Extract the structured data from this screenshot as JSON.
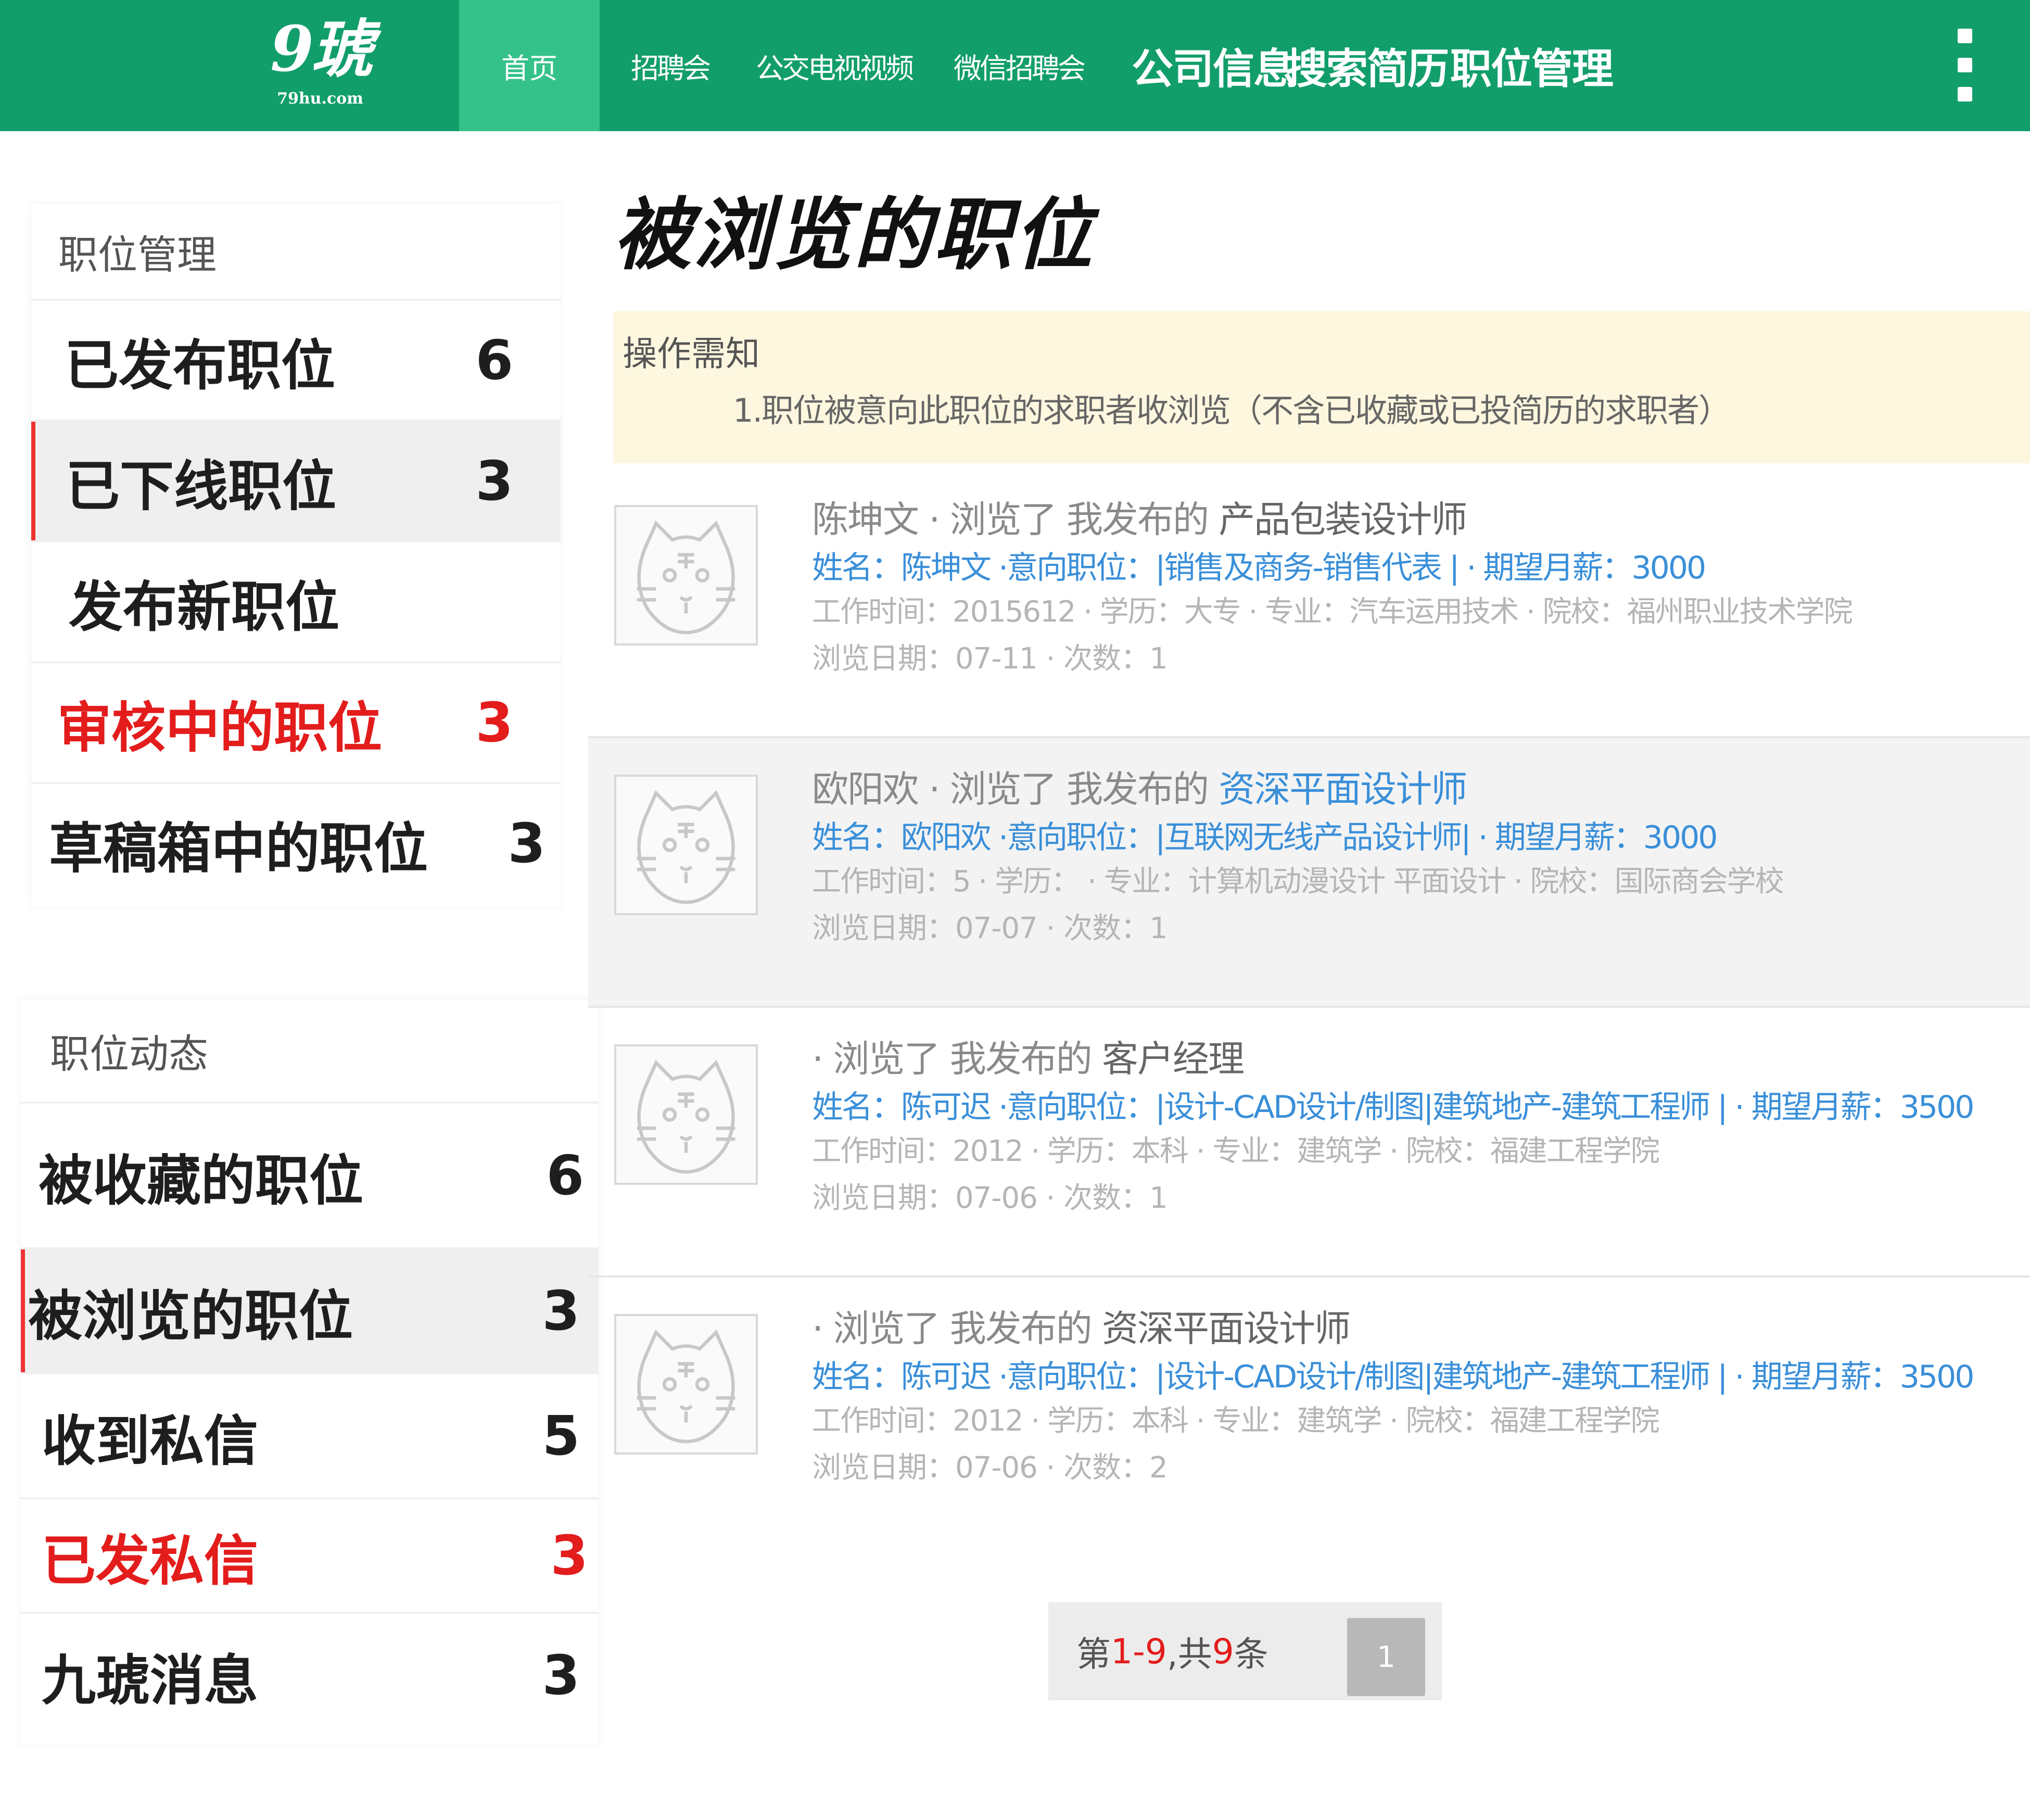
{
  "brand": {
    "logo_main": "9琥",
    "logo_sub": "79hu.com"
  },
  "nav": {
    "home": "首页",
    "items_small": [
      "招聘会",
      "公交电视视频",
      "微信招聘会"
    ],
    "items_big": [
      "公司信息",
      "搜索简历",
      "职位管理"
    ]
  },
  "sidebar": {
    "section1": {
      "title": "职位管理",
      "items": [
        {
          "label": "已发布职位",
          "count": "6"
        },
        {
          "label": "已下线职位",
          "count": "3"
        },
        {
          "label": "发布新职位",
          "count": ""
        },
        {
          "label": "审核中的职位",
          "count": "3"
        },
        {
          "label": "草稿箱中的职位",
          "count": "3"
        }
      ]
    },
    "section2": {
      "title": "职位动态",
      "items": [
        {
          "label": "被收藏的职位",
          "count": "6"
        },
        {
          "label": "被浏览的职位",
          "count": "3"
        },
        {
          "label": "收到私信",
          "count": "5"
        },
        {
          "label": "已发私信",
          "count": "3"
        },
        {
          "label": "九琥消息",
          "count": "3"
        }
      ]
    }
  },
  "main": {
    "title": "被浏览的职位",
    "notice": {
      "title": "操作需知",
      "text": "1.职位被意向此职位的求职者收浏览（不含已收藏或已投简历的求职者）"
    },
    "records": [
      {
        "viewer": "陈坤文",
        "action": " · 浏览了 我发布的 ",
        "job": "产品包装设计师",
        "info": "姓名：陈坤文 ·意向职位：|销售及商务-销售代表 | · 期望月薪：3000",
        "meta": "工作时间：2015612 · 学历：大专 · 专业：汽车运用技术 · 院校：福州职业技术学院",
        "date": "浏览日期：07-11 · 次数：1"
      },
      {
        "viewer": "欧阳欢",
        "action": " · 浏览了 我发布的 ",
        "job": "资深平面设计师",
        "info": "姓名：欧阳欢 ·意向职位：|互联网无线产品设计师| · 期望月薪：3000",
        "meta": "工作时间：5 · 学历： · 专业：计算机动漫设计 平面设计 · 院校：国际商会学校",
        "date": "浏览日期：07-07 · 次数：1"
      },
      {
        "viewer": "",
        "action": "· 浏览了 我发布的 ",
        "job": "客户经理",
        "info": "姓名：陈可迟 ·意向职位：|设计-CAD设计/制图|建筑地产-建筑工程师 | · 期望月薪：3500",
        "meta": "工作时间：2012 · 学历：本科 · 专业：建筑学 · 院校：福建工程学院",
        "date": "浏览日期：07-06 · 次数：1"
      },
      {
        "viewer": "",
        "action": "· 浏览了 我发布的 ",
        "job": "资深平面设计师",
        "info": "姓名：陈可迟 ·意向职位：|设计-CAD设计/制图|建筑地产-建筑工程师 | · 期望月薪：3500",
        "meta": "工作时间：2012 · 学历：本科 · 专业：建筑学 · 院校：福建工程学院",
        "date": "浏览日期：07-06 · 次数：2"
      }
    ]
  },
  "pagination": {
    "prefix": "第",
    "range": "1-9",
    "middle": ",共",
    "total": "9",
    "suffix": "条",
    "current_page": "1"
  },
  "colors": {
    "topbar": "#129e6b",
    "nav_active": "#35c28a",
    "accent_red": "#e31c1c",
    "link_blue": "#3a8fd9",
    "notice_bg": "#fdf7df"
  },
  "icons": {
    "more": "more-vertical-icon",
    "avatar": "tiger-avatar-icon"
  }
}
